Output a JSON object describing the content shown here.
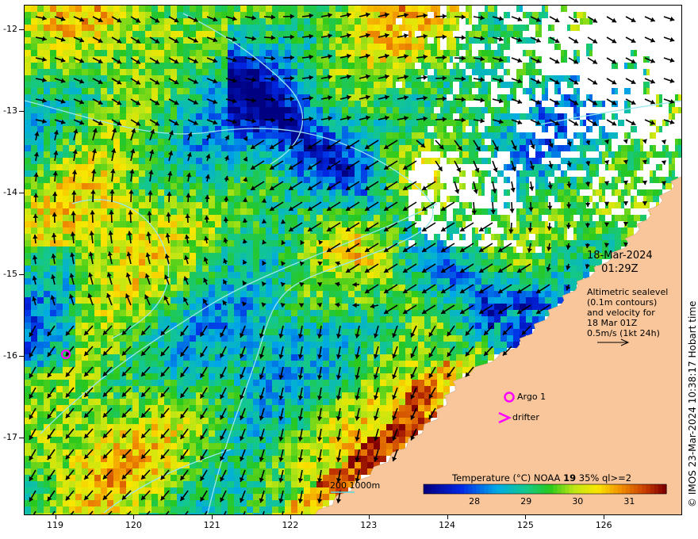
{
  "map": {
    "y_ticks": [
      "-12",
      "-13",
      "-14",
      "-15",
      "-16",
      "-17"
    ],
    "x_ticks": [
      "119",
      "120",
      "121",
      "122",
      "123",
      "124",
      "125",
      "126"
    ],
    "lon_range": [
      118.6,
      127.0
    ],
    "lat_range": [
      -17.95,
      -11.7
    ],
    "land_color": "#f8c69a",
    "cloud_color": "#ffffff",
    "arrow_color": "#000000",
    "contour_color": "#9be7f0"
  },
  "overlay": {
    "date_line1": "18-Mar-2024",
    "date_line2": "01:29Z",
    "alt_line1": "Altimetric sealevel",
    "alt_line2": "(0.1m contours)",
    "alt_line3": "and velocity for",
    "alt_line4": "18 Mar 01Z",
    "alt_line5": "0.5m/s (1kt 24h)",
    "argo_label": "Argo 1",
    "drifter_label": "drifter",
    "contour_legend": "200  1000m"
  },
  "colorbar": {
    "title_prefix": "Temperature (°C) NOAA ",
    "title_bold": "19",
    "title_suffix": " 35% ql>=2",
    "ticks": [
      "28",
      "29",
      "30",
      "31"
    ],
    "range": [
      27.0,
      31.7
    ]
  },
  "credit": "© IMOS 23-Mar-2024 10:38:17 Hobart time",
  "markers": {
    "color": "#ff00ff",
    "argo_icon": "circle-marker",
    "drifter_icon": "chevron-marker"
  }
}
